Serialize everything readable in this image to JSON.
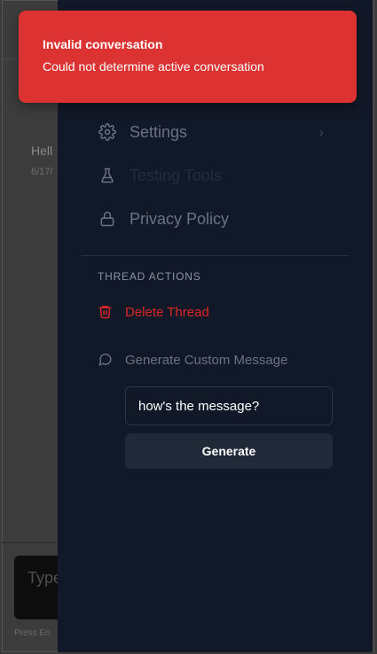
{
  "background": {
    "thread_title": "Hell",
    "thread_date": "6/17/",
    "composer_placeholder": "Type",
    "press_hint": "Press En"
  },
  "toast": {
    "title": "Invalid conversation",
    "message": "Could not determine active conversation",
    "color": "#dc3232"
  },
  "menu": {
    "settings_label": "Settings",
    "testing_label": "Testing Tools",
    "privacy_label": "Privacy Policy"
  },
  "thread_actions": {
    "section_title": "THREAD ACTIONS",
    "delete_label": "Delete Thread",
    "generate_custom_label": "Generate Custom Message",
    "input_value": "how's the message?",
    "generate_button": "Generate"
  },
  "colors": {
    "drawer_bg": "#111827",
    "danger": "#dc2626",
    "button_bg": "#1f2937"
  }
}
